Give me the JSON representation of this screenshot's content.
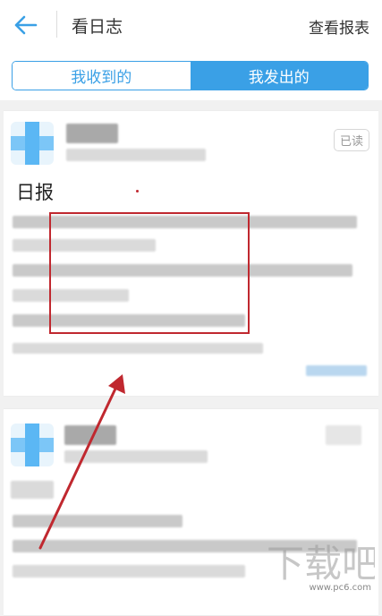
{
  "header": {
    "back_icon": "arrow-left-icon",
    "title": "看日志",
    "report_link": "查看报表"
  },
  "tabs": [
    {
      "label": "我收到的",
      "active": false
    },
    {
      "label": "我发出的",
      "active": true
    }
  ],
  "posts": [
    {
      "status": "已读",
      "title": "日报"
    }
  ],
  "watermark": {
    "url": "www.pc6.com"
  },
  "colors": {
    "accent": "#3aa0e6",
    "annotation": "#c0282f"
  }
}
